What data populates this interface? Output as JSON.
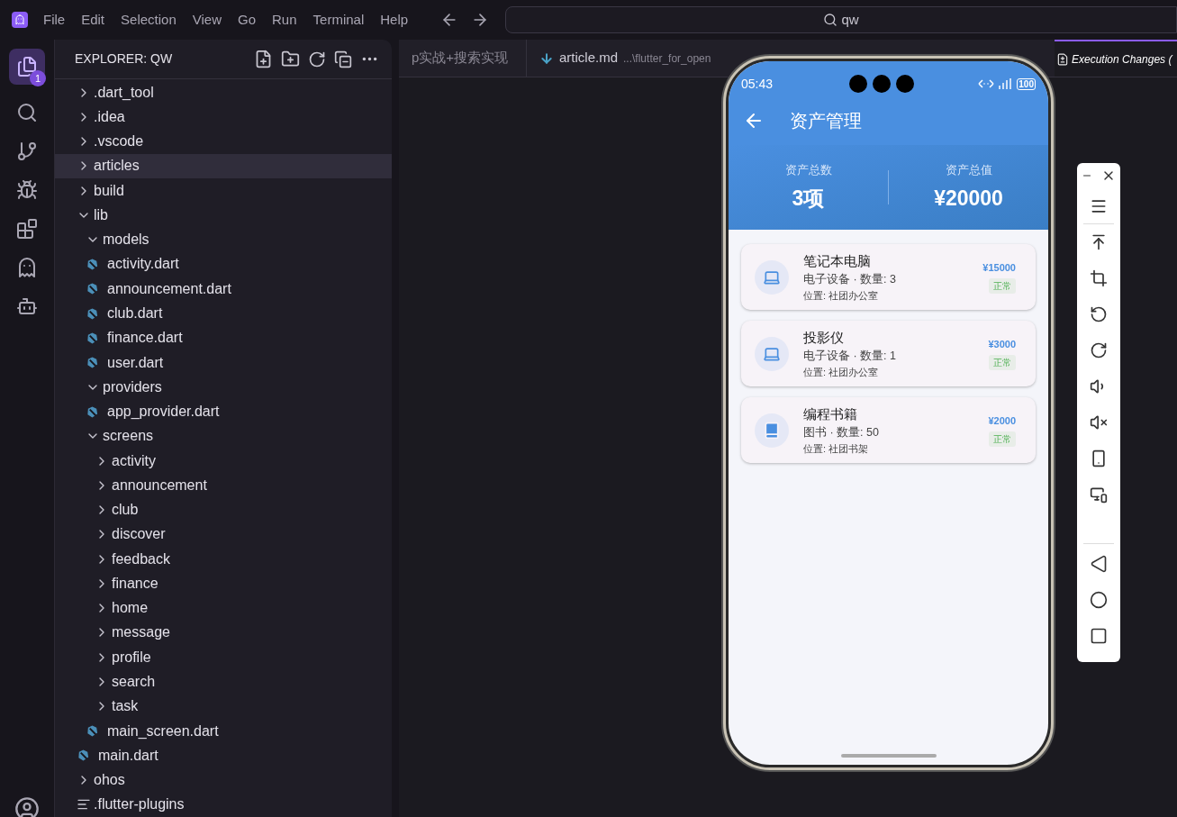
{
  "menu": [
    "File",
    "Edit",
    "Selection",
    "View",
    "Go",
    "Run",
    "Terminal",
    "Help"
  ],
  "search": {
    "value": "qw"
  },
  "activity_bar": {
    "badge": "1"
  },
  "explorer": {
    "title": "EXPLORER: QW",
    "tree": [
      {
        "name": ".dart_tool",
        "kind": "folder",
        "expanded": false,
        "selected": false
      },
      {
        "name": ".idea",
        "kind": "folder",
        "expanded": false,
        "selected": false
      },
      {
        "name": ".vscode",
        "kind": "folder",
        "expanded": false,
        "selected": false
      },
      {
        "name": "articles",
        "kind": "folder",
        "expanded": false,
        "selected": true
      },
      {
        "name": "build",
        "kind": "folder",
        "expanded": false,
        "selected": false
      },
      {
        "name": "lib",
        "kind": "folder",
        "expanded": true,
        "selected": false,
        "children": [
          {
            "name": "models",
            "kind": "folder",
            "expanded": true,
            "selected": false,
            "children": [
              {
                "name": "activity.dart",
                "kind": "dart",
                "selected": false
              },
              {
                "name": "announcement.dart",
                "kind": "dart",
                "selected": false
              },
              {
                "name": "club.dart",
                "kind": "dart",
                "selected": false
              },
              {
                "name": "finance.dart",
                "kind": "dart",
                "selected": false
              },
              {
                "name": "user.dart",
                "kind": "dart",
                "selected": false
              }
            ]
          },
          {
            "name": "providers",
            "kind": "folder",
            "expanded": true,
            "selected": false,
            "children": [
              {
                "name": "app_provider.dart",
                "kind": "dart",
                "selected": false
              }
            ]
          },
          {
            "name": "screens",
            "kind": "folder",
            "expanded": true,
            "selected": false,
            "children": [
              {
                "name": "activity",
                "kind": "folder",
                "expanded": false,
                "selected": false
              },
              {
                "name": "announcement",
                "kind": "folder",
                "expanded": false,
                "selected": false
              },
              {
                "name": "club",
                "kind": "folder",
                "expanded": false,
                "selected": false
              },
              {
                "name": "discover",
                "kind": "folder",
                "expanded": false,
                "selected": false
              },
              {
                "name": "feedback",
                "kind": "folder",
                "expanded": false,
                "selected": false
              },
              {
                "name": "finance",
                "kind": "folder",
                "expanded": false,
                "selected": false
              },
              {
                "name": "home",
                "kind": "folder",
                "expanded": false,
                "selected": false
              },
              {
                "name": "message",
                "kind": "folder",
                "expanded": false,
                "selected": false
              },
              {
                "name": "profile",
                "kind": "folder",
                "expanded": false,
                "selected": false
              },
              {
                "name": "search",
                "kind": "folder",
                "expanded": false,
                "selected": false
              },
              {
                "name": "task",
                "kind": "folder",
                "expanded": false,
                "selected": false
              },
              {
                "name": "main_screen.dart",
                "kind": "dart",
                "selected": false
              }
            ]
          },
          {
            "name": "main.dart",
            "kind": "dart",
            "selected": false
          }
        ]
      },
      {
        "name": "ohos",
        "kind": "folder",
        "expanded": false,
        "selected": false
      },
      {
        "name": ".flutter-plugins",
        "kind": "text",
        "selected": false
      }
    ]
  },
  "tabs": [
    {
      "label": "p实战+搜索实现",
      "selected": false
    },
    {
      "label": "article.md",
      "path": "...\\flutter_for_open",
      "kind": "markdown",
      "selected": false
    },
    {
      "label": "Execution Changes (",
      "kind": "diff",
      "selected": true
    }
  ],
  "phone": {
    "time": "05:43",
    "battery": "100",
    "title": "资产管理",
    "summary": [
      {
        "label": "资产总数",
        "value": "3项"
      },
      {
        "label": "资产总值",
        "value": "¥20000"
      }
    ],
    "assets": [
      {
        "kind": "laptop",
        "name": "笔记本电脑",
        "meta": "电子设备 · 数量: 3",
        "location": "位置: 社团办公室",
        "price": "¥15000",
        "status": "正常"
      },
      {
        "kind": "laptop",
        "name": "投影仪",
        "meta": "电子设备 · 数量: 1",
        "location": "位置: 社团办公室",
        "price": "¥3000",
        "status": "正常"
      },
      {
        "kind": "book",
        "name": "编程书籍",
        "meta": "图书 · 数量: 50",
        "location": "位置: 社团书架",
        "price": "¥2000",
        "status": "正常"
      }
    ]
  }
}
